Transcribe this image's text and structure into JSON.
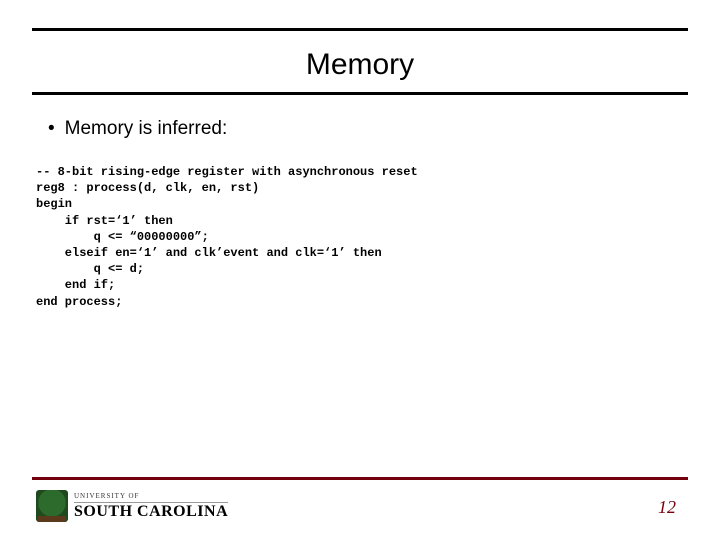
{
  "title": "Memory",
  "bullet": "Memory is inferred:",
  "code": "-- 8-bit rising-edge register with asynchronous reset\nreg8 : process(d, clk, en, rst)\nbegin\n    if rst=‘1’ then\n        q <= “00000000”;\n    elseif en=‘1’ and clk’event and clk=‘1’ then\n        q <= d;\n    end if;\nend process;",
  "logo": {
    "top": "UNIVERSITY OF",
    "main": "SOUTH CAROLINA"
  },
  "page_number": "12"
}
